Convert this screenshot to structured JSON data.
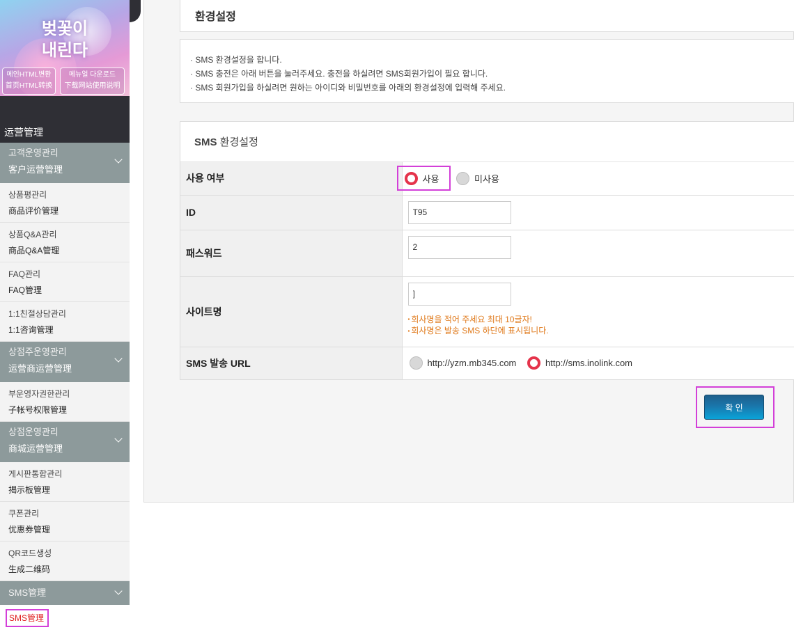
{
  "banner": {
    "title_line1": "벚꽃이",
    "title_line2": "내린다",
    "btn1": {
      "line1": "메인HTML변환",
      "line2": "首页HTML转换"
    },
    "btn2": {
      "line1": "메뉴얼 다운로드",
      "line2": "下载网站使用说明"
    }
  },
  "sidebar": {
    "header": "运营管理",
    "groups": [
      {
        "label_ko": "고객운영관리",
        "label_zh": "客户运营管理",
        "items": [
          {
            "ko": "상품평관리",
            "zh": "商品评价管理"
          },
          {
            "ko": "상품Q&A관리",
            "zh": "商品Q&A管理"
          },
          {
            "ko": "FAQ관리",
            "zh": "FAQ管理"
          },
          {
            "ko": "1:1친절상담관리",
            "zh": "1:1咨询管理"
          }
        ]
      },
      {
        "label_ko": "상점주운영관리",
        "label_zh": "运营商运营管理",
        "items": [
          {
            "ko": "부운영자권한관리",
            "zh": "子帐号权限管理"
          }
        ]
      },
      {
        "label_ko": "상점운영관리",
        "label_zh": "商城运营管理",
        "items": [
          {
            "ko": "게시판통합관리",
            "zh": "揭示板管理"
          },
          {
            "ko": "쿠폰관리",
            "zh": "优惠券管理"
          },
          {
            "ko": "QR코드생성",
            "zh": "生成二维码"
          }
        ]
      },
      {
        "label": "SMS管理",
        "sub": "SMS管理"
      }
    ]
  },
  "page": {
    "title": "환경설정",
    "notices": [
      "· SMS 환경설정을 합니다.",
      "· SMS 충전은 아래 버튼을 눌러주세요. 충전을 하실려면 SMS회원가입이 필요 합니다.",
      "· SMS 회원가입을 하실려면 원하는 아이디와 비밀번호를 아래의 환경설정에 입력해 주세요."
    ],
    "section_title_bold": "SMS",
    "section_title_rest": " 환경설정"
  },
  "form": {
    "use": {
      "label": "사용 여부",
      "opt_on": "사용",
      "opt_off": "미사용",
      "selected": "사용"
    },
    "id": {
      "label": "ID",
      "value": "T95"
    },
    "password": {
      "label": "패스워드",
      "value": "2"
    },
    "site": {
      "label": "사이트명",
      "value": "]",
      "hint1": "회사명을 적어 주세요 최대 10글자!",
      "hint2": "회사명은 발송 SMS 하단에 표시됩니다."
    },
    "url": {
      "label_bold": "SMS",
      "label_rest": " 발송 URL",
      "opt1": "http://yzm.mb345.com",
      "opt2": "http://sms.inolink.com",
      "selected": "http://sms.inolink.com"
    },
    "confirm": "확 인"
  },
  "colors": {
    "accent_radio": "#e5334b",
    "highlight": "#d33fd8",
    "sidebar_group": "#8d9a9b",
    "sidebar_dark": "#2f2f35",
    "hint": "#e07a1c"
  }
}
